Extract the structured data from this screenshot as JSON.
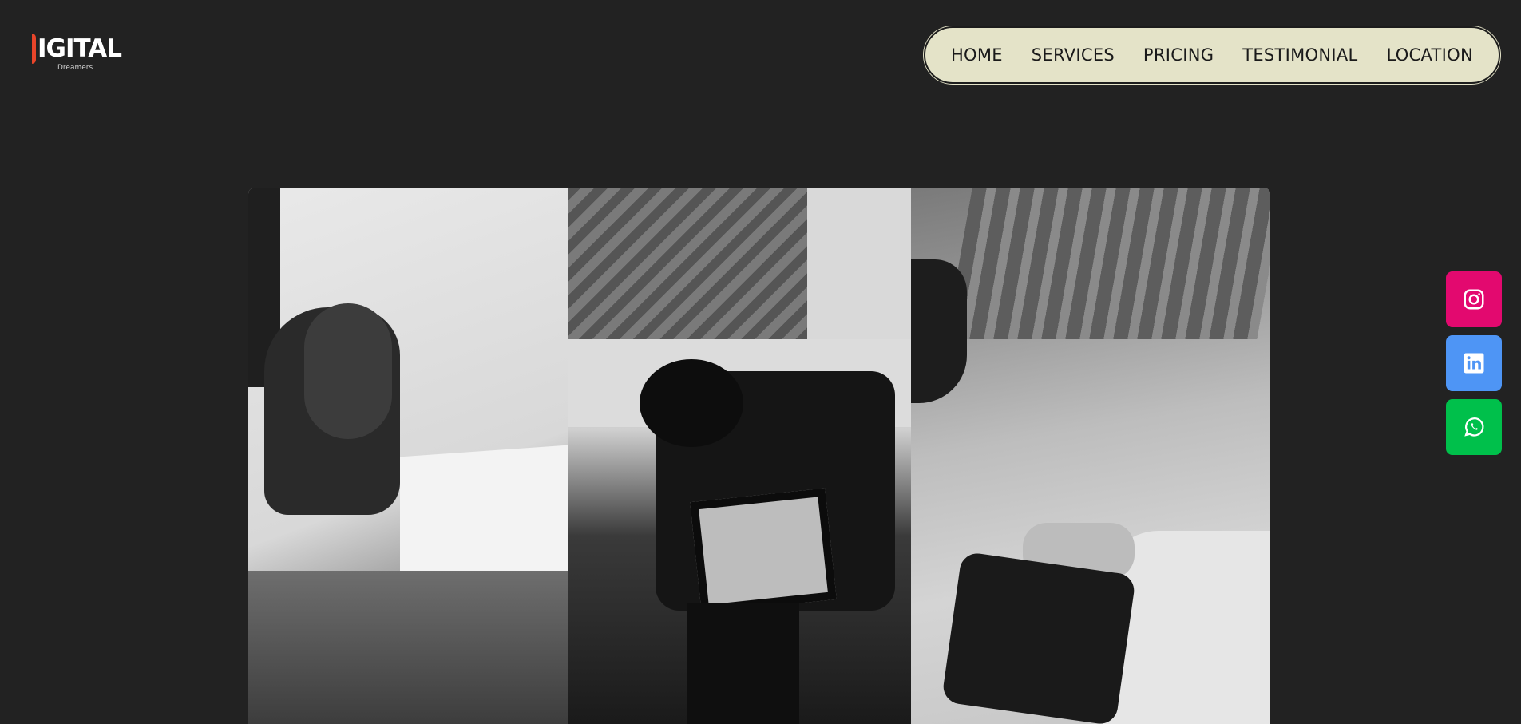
{
  "brand": {
    "logo_text": "IGITAL",
    "logo_sub": "Dreamers",
    "logo_accent": "#e8452a"
  },
  "nav": {
    "items": [
      {
        "label": "HOME"
      },
      {
        "label": "SERVICES"
      },
      {
        "label": "PRICING"
      },
      {
        "label": "TESTIMONIAL"
      },
      {
        "label": "LOCATION"
      }
    ],
    "background": "#e4e3c8"
  },
  "gallery": {
    "images": [
      {
        "description_icon": "photoshoot-product-image"
      },
      {
        "description_icon": "camera-screen-image"
      },
      {
        "description_icon": "hands-camera-image"
      }
    ]
  },
  "social": [
    {
      "name": "instagram-icon",
      "color": "#e3096f"
    },
    {
      "name": "linkedin-icon",
      "color": "#4e95f5"
    },
    {
      "name": "whatsapp-icon",
      "color": "#00c04b"
    }
  ],
  "colors": {
    "page_background": "#222222"
  }
}
